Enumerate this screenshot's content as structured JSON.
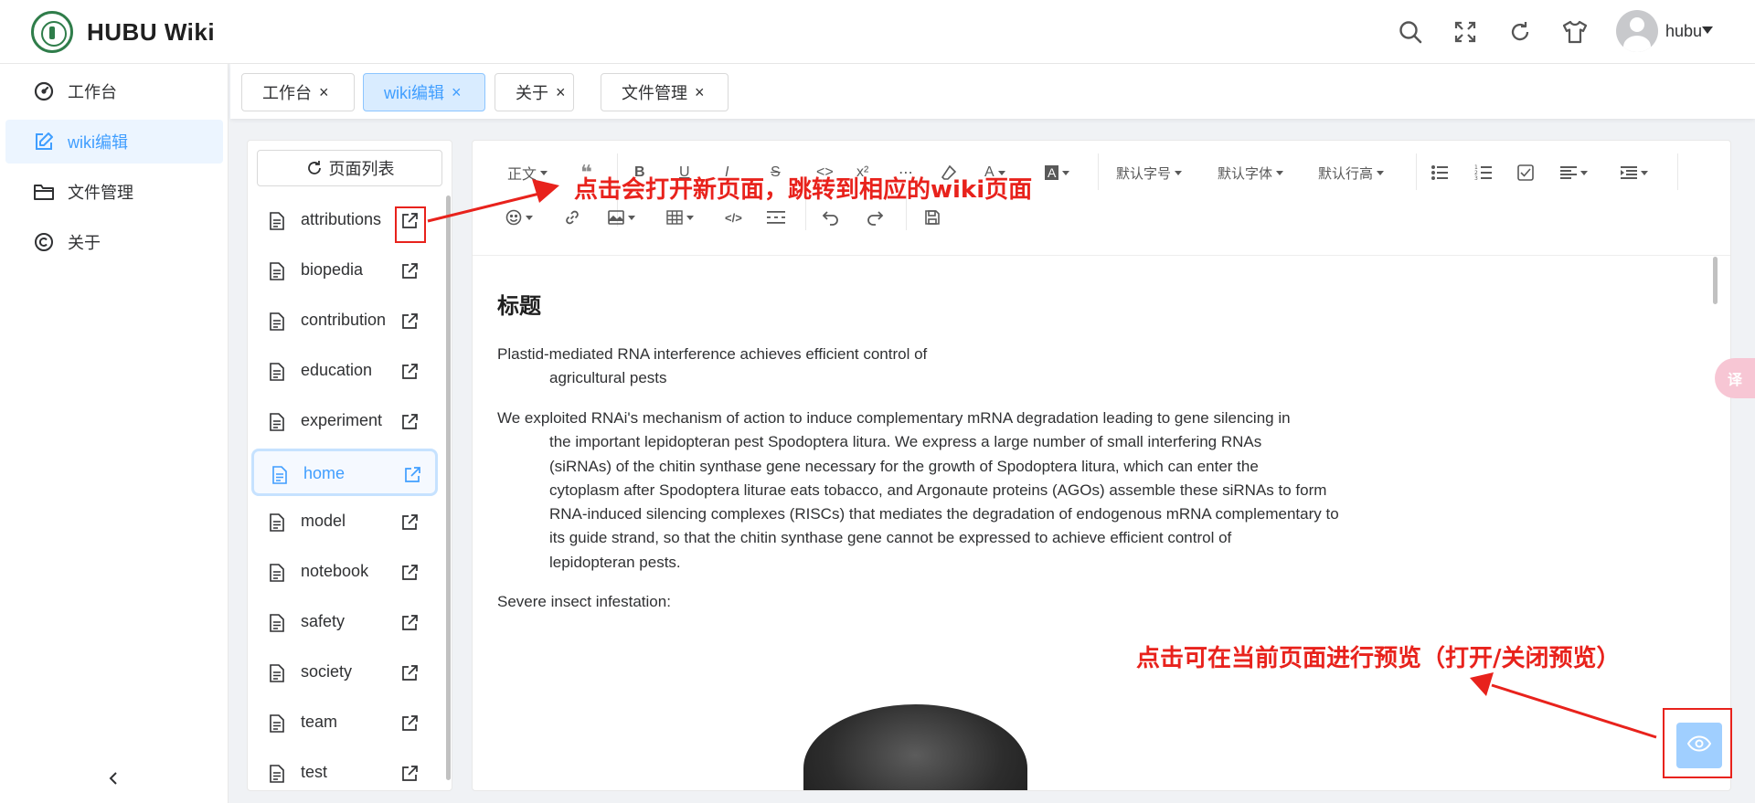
{
  "app": {
    "title": "HUBU Wiki"
  },
  "header": {
    "user_name": "hubu"
  },
  "sidebar": {
    "items": [
      {
        "label": "工作台"
      },
      {
        "label": "wiki编辑"
      },
      {
        "label": "文件管理"
      },
      {
        "label": "关于"
      }
    ],
    "active_index": 1
  },
  "tabs": [
    {
      "label": "工作台"
    },
    {
      "label": "wiki编辑"
    },
    {
      "label": "关于"
    },
    {
      "label": "文件管理"
    }
  ],
  "pagelist": {
    "refresh_label": "页面列表",
    "pages": [
      "attributions",
      "biopedia",
      "contribution",
      "education",
      "experiment",
      "home",
      "model",
      "notebook",
      "safety",
      "society",
      "team",
      "test"
    ],
    "active": "home"
  },
  "toolbar": {
    "paragraph": "正文",
    "font_size": "默认字号",
    "font_family": "默认字体",
    "line_height": "默认行高"
  },
  "document": {
    "title": "标题",
    "paragraphs": [
      {
        "first": "Plastid-mediated RNA interference achieves efficient control of",
        "rest": [
          "agricultural pests"
        ]
      },
      {
        "first": "We exploited RNAi's mechanism of action to induce complementary mRNA degradation leading to gene silencing in",
        "rest": [
          "the important lepidopteran pest Spodoptera litura. We express a large number of small interfering RNAs",
          "(siRNAs) of the chitin synthase gene necessary for the growth of Spodoptera litura, which can enter the",
          "cytoplasm after Spodoptera liturae eats tobacco, and Argonaute proteins (AGOs) assemble these siRNAs to form",
          "RNA-induced silencing complexes (RISCs) that mediates the degradation of endogenous mRNA complementary to",
          "its guide strand, so that the chitin synthase gene cannot be expressed to achieve efficient control of",
          "lepidopteran pests."
        ]
      },
      {
        "first": "Severe insect infestation:",
        "rest": []
      }
    ]
  },
  "annotations": {
    "open_page": "点击会打开新页面，跳转到相应的wiki页面",
    "preview": "点击可在当前页面进行预览（打开/关闭预览）"
  },
  "floating": {
    "translate": "译"
  },
  "colors": {
    "accent": "#409eff",
    "annotation": "#e8221c"
  }
}
